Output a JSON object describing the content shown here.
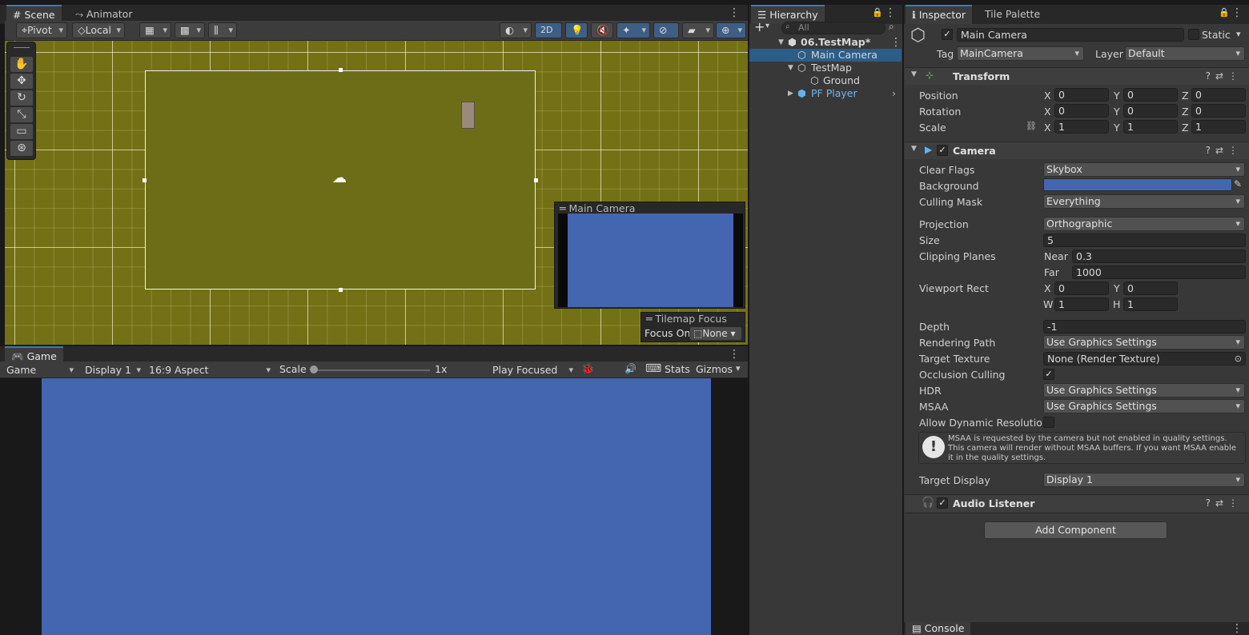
{
  "scene_window": {
    "tabs": [
      {
        "label": "Scene",
        "icon": "hash-icon"
      },
      {
        "label": "Animator",
        "icon": "animator-icon"
      }
    ],
    "toolbar": {
      "pivot": "Pivot",
      "local": "Local",
      "mode_2d": "2D"
    },
    "overlays": {
      "camera_preview_title": "Main Camera",
      "tilemap_focus_title": "Tilemap Focus",
      "focus_on_label": "Focus On",
      "focus_on_value": "None"
    }
  },
  "game_window": {
    "tab": "Game",
    "toolbar": {
      "view": "Game",
      "display": "Display 1",
      "aspect": "16:9 Aspect",
      "scale_label": "Scale",
      "scale_value": "1x",
      "play_mode": "Play Focused",
      "stats": "Stats",
      "gizmos": "Gizmos"
    },
    "background_color": "#4466b0"
  },
  "hierarchy": {
    "tab": "Hierarchy",
    "search_placeholder": "All",
    "items": [
      {
        "label": "06.TestMap*",
        "bold": true
      },
      {
        "label": "Main Camera",
        "selected": true
      },
      {
        "label": "TestMap"
      },
      {
        "label": "Ground"
      },
      {
        "label": "PF Player",
        "prefab": true
      }
    ]
  },
  "inspector": {
    "tabs": [
      {
        "label": "Inspector"
      },
      {
        "label": "Tile Palette"
      }
    ],
    "object_name": "Main Camera",
    "static_label": "Static",
    "tag_label": "Tag",
    "tag_value": "MainCamera",
    "layer_label": "Layer",
    "layer_value": "Default",
    "transform": {
      "title": "Transform",
      "position_label": "Position",
      "rotation_label": "Rotation",
      "scale_label": "Scale",
      "position": {
        "x": "0",
        "y": "0",
        "z": "0"
      },
      "rotation": {
        "x": "0",
        "y": "0",
        "z": "0"
      },
      "scale": {
        "x": "1",
        "y": "1",
        "z": "1"
      }
    },
    "camera": {
      "title": "Camera",
      "clear_flags_label": "Clear Flags",
      "clear_flags": "Skybox",
      "background_label": "Background",
      "background_color": "#4466b0",
      "culling_mask_label": "Culling Mask",
      "culling_mask": "Everything",
      "projection_label": "Projection",
      "projection": "Orthographic",
      "size_label": "Size",
      "size": "5",
      "clipping_label": "Clipping Planes",
      "near_label": "Near",
      "near": "0.3",
      "far_label": "Far",
      "far": "1000",
      "viewport_label": "Viewport Rect",
      "viewport": {
        "x": "0",
        "y": "0",
        "w": "1",
        "h": "1"
      },
      "depth_label": "Depth",
      "depth": "-1",
      "rendering_path_label": "Rendering Path",
      "rendering_path": "Use Graphics Settings",
      "target_texture_label": "Target Texture",
      "target_texture": "None (Render Texture)",
      "occlusion_label": "Occlusion Culling",
      "hdr_label": "HDR",
      "hdr": "Use Graphics Settings",
      "msaa_label": "MSAA",
      "msaa": "Use Graphics Settings",
      "dynres_label": "Allow Dynamic Resolution",
      "warning": "MSAA is requested by the camera but not enabled in quality settings. This camera will render without MSAA buffers. If you want MSAA enable it in the quality settings.",
      "target_display_label": "Target Display",
      "target_display": "Display 1"
    },
    "audio_listener": {
      "title": "Audio Listener"
    },
    "add_component": "Add Component"
  },
  "console": {
    "tab": "Console"
  }
}
